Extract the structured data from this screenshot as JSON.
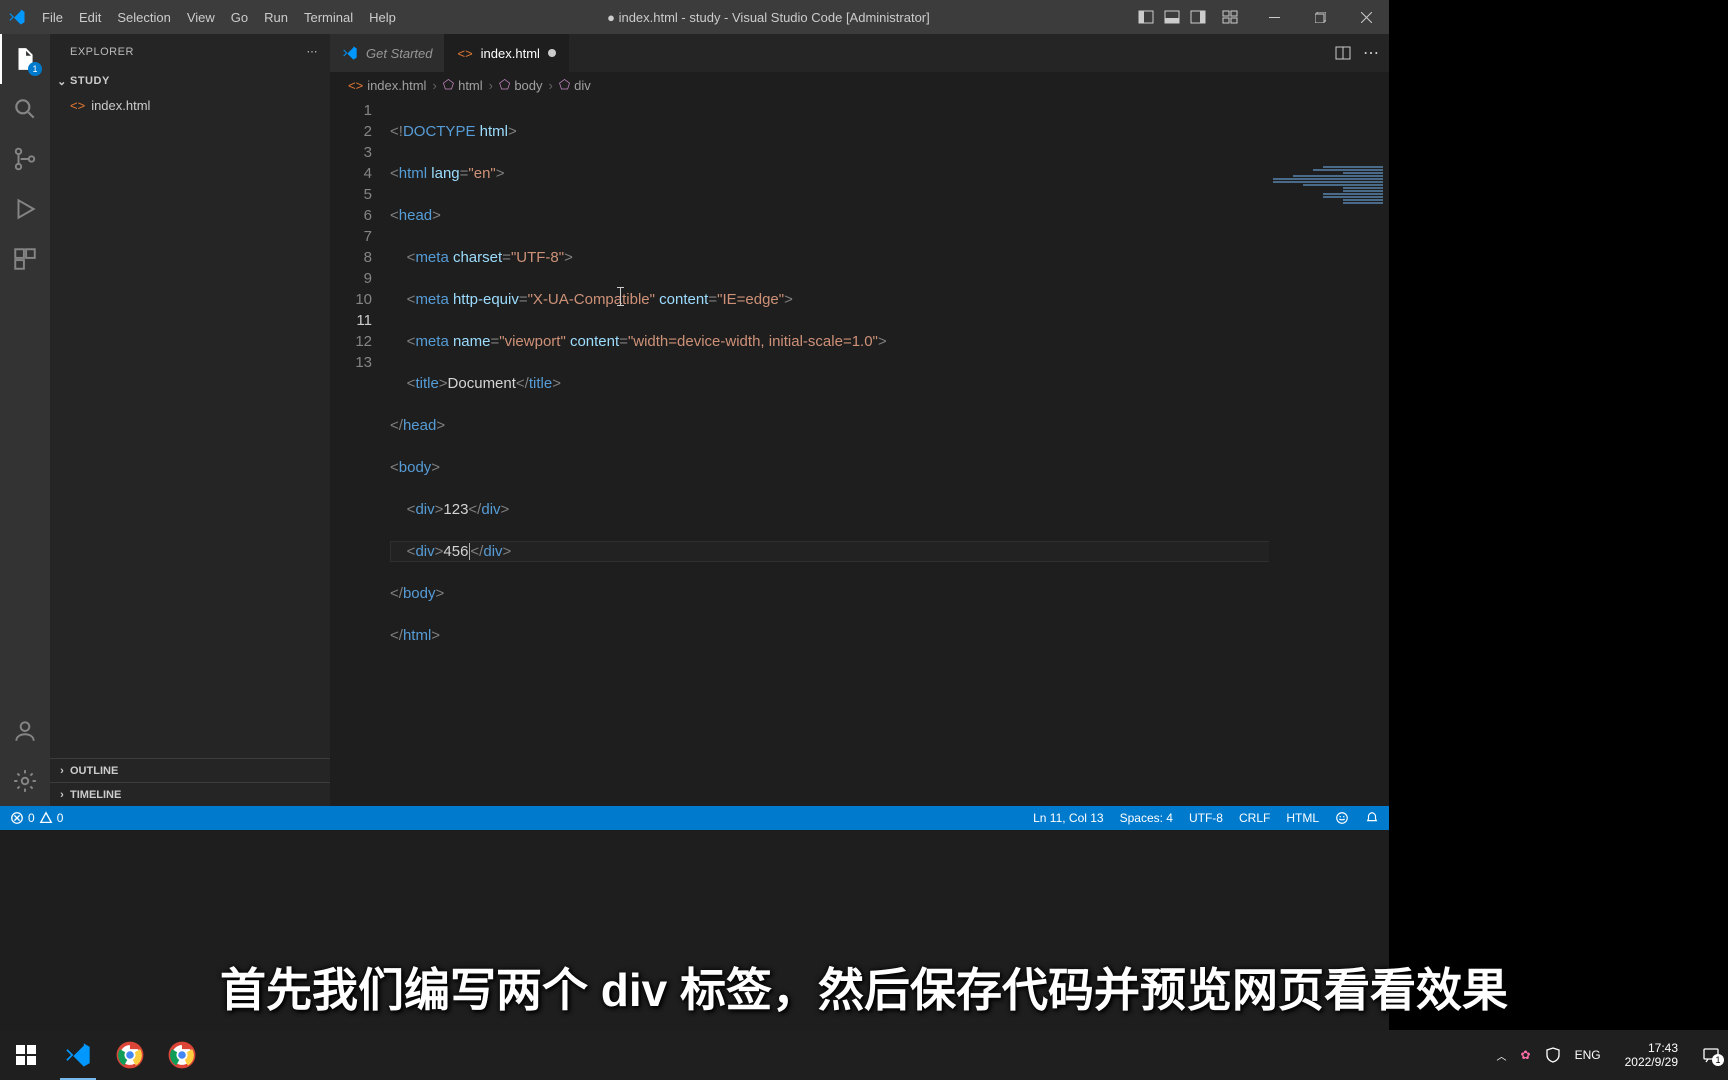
{
  "titlebar": {
    "title": "● index.html - study - Visual Studio Code [Administrator]",
    "menu": [
      "File",
      "Edit",
      "Selection",
      "View",
      "Go",
      "Run",
      "Terminal",
      "Help"
    ]
  },
  "activitybar": {
    "explorer_badge": "1"
  },
  "sidebar": {
    "title": "EXPLORER",
    "folder": "STUDY",
    "files": [
      {
        "name": "index.html"
      }
    ],
    "outline": "OUTLINE",
    "timeline": "TIMELINE"
  },
  "tabs": {
    "tab0": {
      "label": "Get Started"
    },
    "tab1": {
      "label": "index.html"
    }
  },
  "breadcrumbs": {
    "b0": "index.html",
    "b1": "html",
    "b2": "body",
    "b3": "div"
  },
  "code": {
    "l1": "<!DOCTYPE html>",
    "l2_tag": "html",
    "l2_attr": "lang",
    "l2_val": "\"en\"",
    "l3_tag": "head",
    "l4_tag": "meta",
    "l4_a1": "charset",
    "l4_v1": "\"UTF-8\"",
    "l5_tag": "meta",
    "l5_a1": "http-equiv",
    "l5_v1": "\"X-UA-Compatible\"",
    "l5_a2": "content",
    "l5_v2": "\"IE=edge\"",
    "l6_tag": "meta",
    "l6_a1": "name",
    "l6_v1": "\"viewport\"",
    "l6_a2": "content",
    "l6_v2": "\"width=device-width, initial-scale=1.0\"",
    "l7_tag": "title",
    "l7_text": "Document",
    "l8_tag": "head",
    "l9_tag": "body",
    "l10_tag": "div",
    "l10_text": "123",
    "l11_tag": "div",
    "l11_text": "456",
    "l12_tag": "body",
    "l13_tag": "html"
  },
  "statusbar": {
    "errors": "0",
    "warnings": "0",
    "ln_col": "Ln 11, Col 13",
    "spaces": "Spaces: 4",
    "encoding": "UTF-8",
    "eol": "CRLF",
    "language": "HTML"
  },
  "taskbar": {
    "lang": "ENG",
    "time": "17:43",
    "date": "2022/9/29",
    "notifications": "1"
  },
  "subtitle": "首先我们编写两个 div 标签，然后保存代码并预览网页看看效果"
}
